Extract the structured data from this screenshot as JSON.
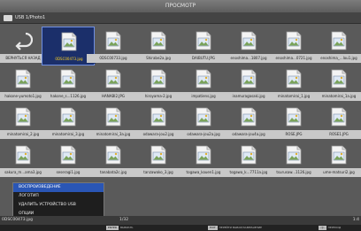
{
  "header": {
    "title": "ПРОСМОТР"
  },
  "path": {
    "text": "USB 1/Photo1"
  },
  "tiles": [
    {
      "label": "ВЕРНУТЬСЯ НАЗАД"
    },
    {
      "label": "0DSC00473.jpg"
    },
    {
      "label": "0DSC00733.jpg"
    },
    {
      "label": "Shirabe2a.jpg"
    },
    {
      "label": "DAIBUTU.JPG"
    },
    {
      "label": "enoshima...1807.jpg"
    },
    {
      "label": "enoshima...0721.jpg"
    },
    {
      "label": "enoshima_...lou1.jpg"
    },
    {
      "label": "hakone-yumoto1.jpg"
    },
    {
      "label": "hakone_s...1126.jpg"
    },
    {
      "label": "HANABI2.JPG"
    },
    {
      "label": "hiroyama-2.jpg"
    },
    {
      "label": "impatiens.jpg"
    },
    {
      "label": "inamuragasaki.jpg"
    },
    {
      "label": "minatomirai_1.jpg"
    },
    {
      "label": "minatomirai_1a.jpg"
    },
    {
      "label": "minatomirai_2.jpg"
    },
    {
      "label": "minatomirai_3.jpg"
    },
    {
      "label": "minatomirai_3a.jpg"
    },
    {
      "label": "odawara-jou2.jpg"
    },
    {
      "label": "odawara-jou2a.jpg"
    },
    {
      "label": "odawara-jou4a.jpg"
    },
    {
      "label": "ROSE.JPG"
    },
    {
      "label": "ROSE1.JPG"
    },
    {
      "label": "sakura_m...ama3.jpg"
    },
    {
      "label": "seseragi1.jpg"
    },
    {
      "label": "tanabata2c.jpg"
    },
    {
      "label": "tanzawako_3.jpg"
    },
    {
      "label": "togawa_kouen1.jpg"
    },
    {
      "label": "togawa_k...7711a.jpg"
    },
    {
      "label": "tsurusaw...1126.jpg"
    },
    {
      "label": "ume-matsuri2.jpg"
    },
    {
      "label": ""
    },
    {
      "label": ""
    },
    {
      "label": ""
    },
    {
      "label": ""
    },
    {
      "label": ""
    },
    {
      "label": ""
    },
    {
      "label": ""
    },
    {
      "label": ""
    }
  ],
  "menu": [
    {
      "label": "ВОСПРОИЗВЕДЕНИЕ"
    },
    {
      "label": "ЛОГОТИП"
    },
    {
      "label": "УДАЛИТЬ УСТРОЙСТВО USB"
    },
    {
      "label": "ОПЦИИ"
    }
  ],
  "status": {
    "filename": "0DSC00473.jpg",
    "counter": "1/32",
    "zoom": "1:4"
  },
  "hints": [
    {
      "key": "ENTER",
      "label": "ВЫБРАТЬ"
    },
    {
      "key": "EXIT",
      "label": "ПЕРЕЙТИ ВЫБОР/ЗАВЕРШЕНИЕ"
    },
    {
      "key": "◁▷",
      "label": "ПЕРЕХОД"
    }
  ],
  "colors": {
    "selected_bg": "#1b2f6a",
    "selected_text": "#ffd21e",
    "menu_active": "#2a56b5"
  },
  "icons": {
    "back": "return-arrow-icon",
    "file": "image-file-icon",
    "folder": "usb-folder-icon"
  }
}
